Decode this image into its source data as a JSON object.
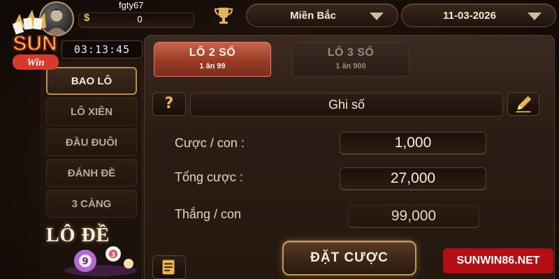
{
  "user": {
    "name": "fgty67",
    "currency_symbol": "$",
    "balance": "0"
  },
  "header": {
    "region": "Miền Bắc",
    "date": "11-03-2026"
  },
  "logo": {
    "text_main": "SUN",
    "text_sub": "Win"
  },
  "timer": "03:13:45",
  "sidebar": {
    "items": [
      {
        "label": "BAO LÔ",
        "active": true
      },
      {
        "label": "LÔ XIÊN",
        "active": false
      },
      {
        "label": "ĐẦU ĐUÔI",
        "active": false
      },
      {
        "label": "ĐÁNH ĐỀ",
        "active": false
      },
      {
        "label": "3 CÀNG",
        "active": false
      }
    ],
    "game_title": "LÔ ĐỀ"
  },
  "tabs": [
    {
      "label": "LÔ 2 SỐ",
      "sub": "1 ăn 99",
      "active": true
    },
    {
      "label": "LÔ 3 SỐ",
      "sub": "1 ăn 900",
      "active": false
    }
  ],
  "number_input": {
    "placeholder": "Ghi số",
    "help_label": "?"
  },
  "rows": {
    "bet_per": {
      "label": "Cược / con :",
      "value": "1,000"
    },
    "total_bet": {
      "label": "Tổng cược :",
      "value": "27,000"
    },
    "win_per": {
      "label": "Thắng / con",
      "value": "99,000"
    }
  },
  "actions": {
    "place_bet": "ĐẶT CƯỢC"
  },
  "watermark": "SUNWIN86.NET",
  "colors": {
    "accent_gold": "#c39a5c",
    "tab_active": "#b14a31",
    "watermark_red": "#b50d14"
  },
  "icons": [
    "avatar",
    "dollar-icon",
    "trophy-icon",
    "chevron-down-icon",
    "help-icon",
    "pencil-icon",
    "notes-icon",
    "lottery-balls-icon"
  ]
}
